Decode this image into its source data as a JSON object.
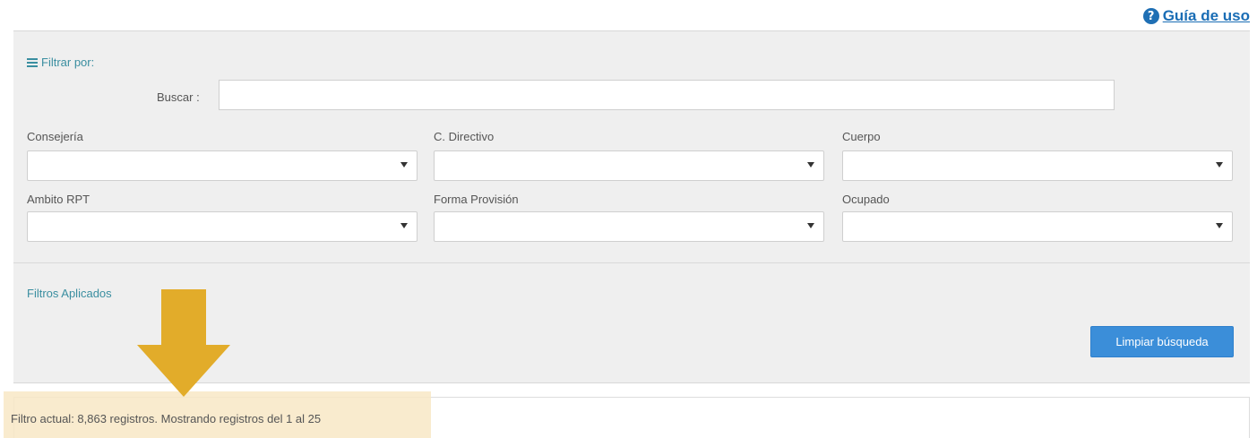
{
  "help": {
    "label": "Guía de uso",
    "icon": "question-circle-icon"
  },
  "filters": {
    "title": "Filtrar por:",
    "search_label": "Buscar :",
    "search_value": "",
    "fields": [
      {
        "label": "Consejería",
        "value": ""
      },
      {
        "label": "C. Directivo",
        "value": ""
      },
      {
        "label": "Cuerpo",
        "value": ""
      },
      {
        "label": "Ambito RPT",
        "value": ""
      },
      {
        "label": "Forma Provisión",
        "value": ""
      },
      {
        "label": "Ocupado",
        "value": ""
      }
    ]
  },
  "applied": {
    "title": "Filtros Aplicados"
  },
  "actions": {
    "clear_label": "Limpiar búsqueda"
  },
  "results": {
    "summary": "Filtro actual: 8,863 registros. Mostrando registros del 1 al 25"
  },
  "colors": {
    "accent": "#3a8ea0",
    "button": "#3b8ed9",
    "arrow": "#e2ac2a",
    "highlight": "#f8e7c5",
    "link": "#1a6db5"
  }
}
